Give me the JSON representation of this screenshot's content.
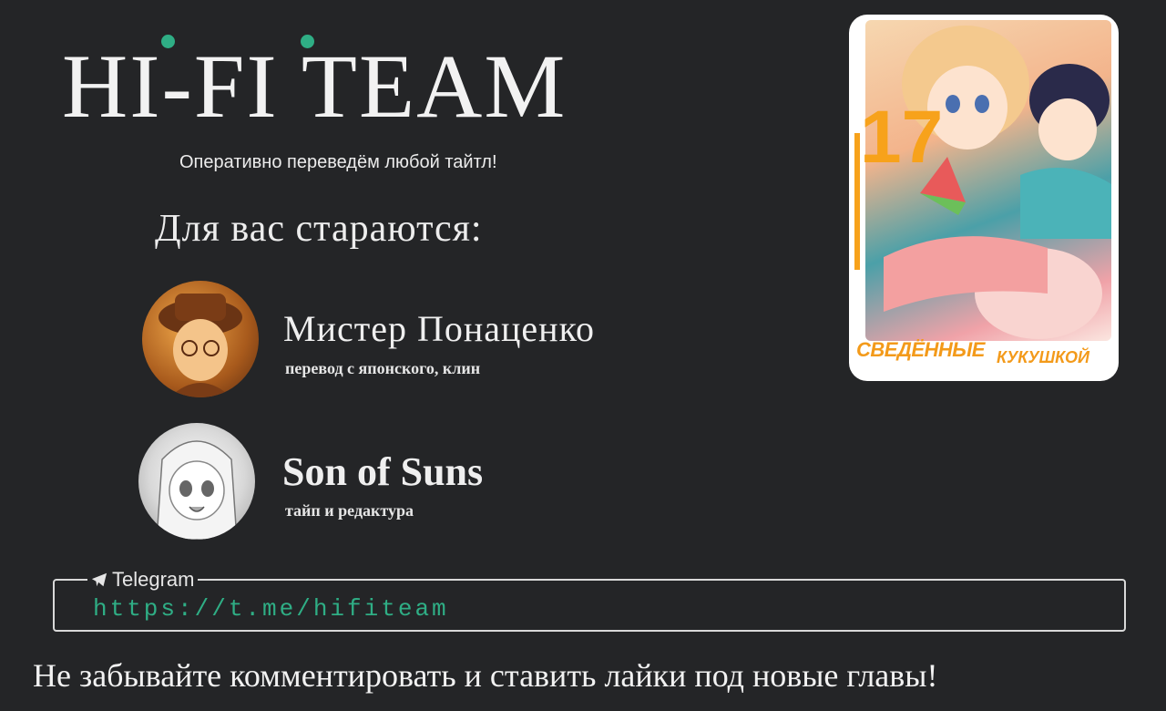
{
  "logo": {
    "text": "HI-FI TEAM"
  },
  "tagline": "Оперативно переведём любой тайтл!",
  "credits_title": "Для вас стараются:",
  "members": [
    {
      "name": "Мистер Понаценко",
      "role": "перевод с японского, клин"
    },
    {
      "name": "Son of Suns",
      "role": "тайп и редактура"
    }
  ],
  "cover": {
    "number": "17",
    "title_line1": "СВЕДЁННЫЕ",
    "title_line2": "КУКУШКОЙ"
  },
  "telegram": {
    "label": "Telegram",
    "link": "https://t.me/hifiteam"
  },
  "footer": "Не забывайте комментировать и ставить лайки под новые главы!",
  "colors": {
    "background": "#242527",
    "accent": "#2fae85",
    "cover_accent": "#f7a21b"
  }
}
